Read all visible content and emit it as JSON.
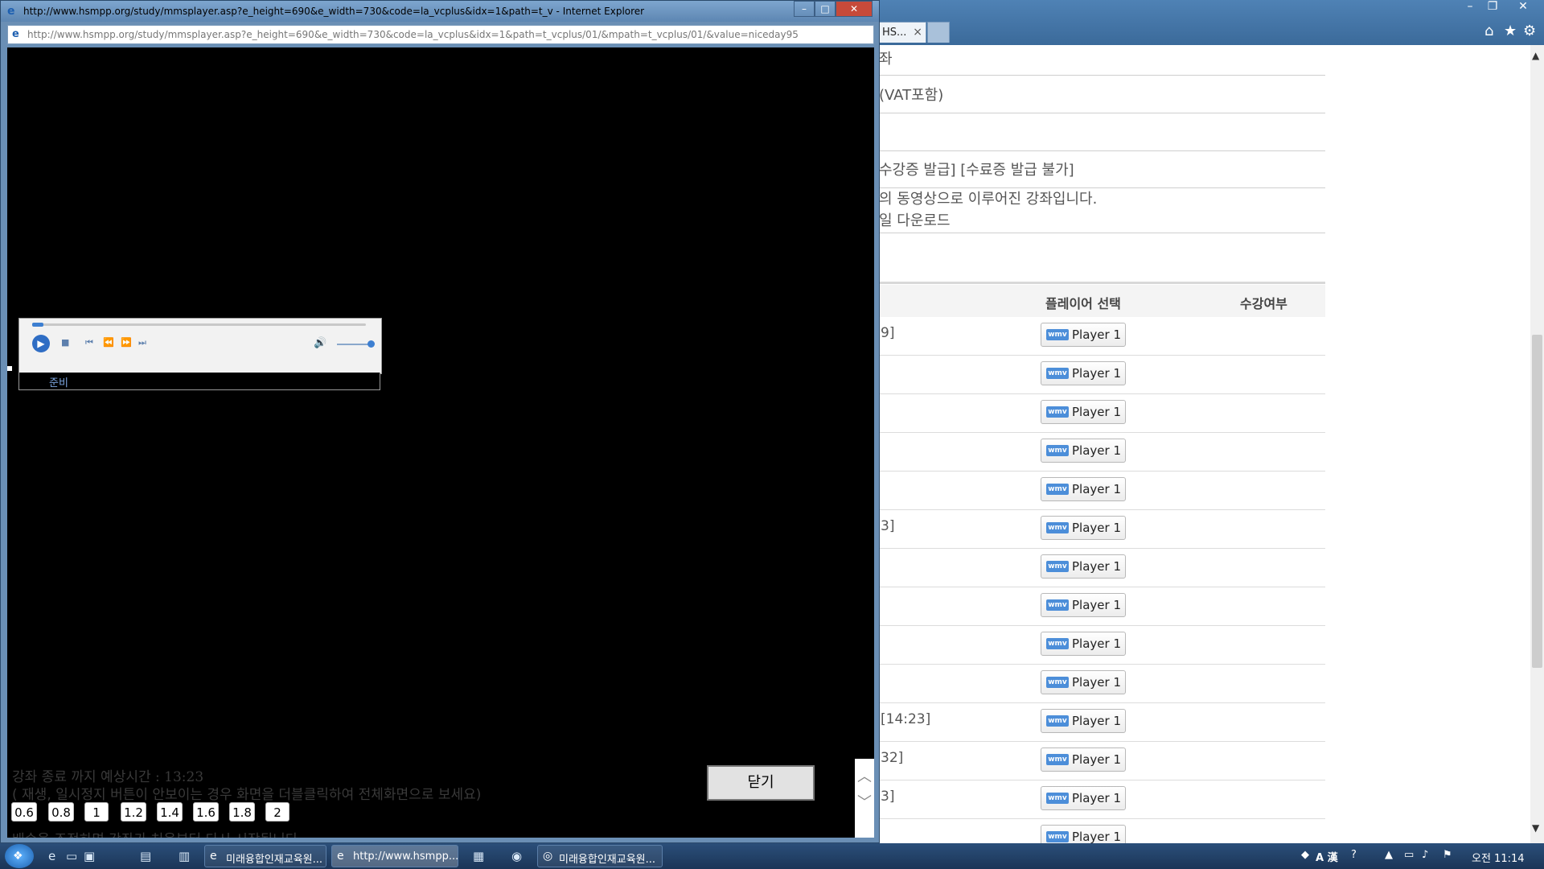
{
  "background_window": {
    "tab_label": "HS...",
    "info_lines": [
      "좌",
      "(VAT포함)",
      "수강증 발급] [수료증 발급 불가]",
      "의 동영상으로 이루어진 강좌입니다.",
      "일 다운로드"
    ],
    "table_headers": {
      "player": "플레이어 선택",
      "status": "수강여부"
    },
    "rows": [
      {
        "text": "9]",
        "button": "Player 1"
      },
      {
        "text": "",
        "button": "Player 1"
      },
      {
        "text": "",
        "button": "Player 1"
      },
      {
        "text": "",
        "button": "Player 1"
      },
      {
        "text": "",
        "button": "Player 1"
      },
      {
        "text": "3]",
        "button": "Player 1"
      },
      {
        "text": "",
        "button": "Player 1"
      },
      {
        "text": "",
        "button": "Player 1"
      },
      {
        "text": "",
        "button": "Player 1"
      },
      {
        "text": "",
        "button": "Player 1"
      },
      {
        "text": "[14:23]",
        "button": "Player 1"
      },
      {
        "text": "32]",
        "button": "Player 1"
      },
      {
        "text": "3]",
        "button": "Player 1"
      },
      {
        "text": "",
        "button": "Player 1"
      }
    ],
    "wmv_badge": "wmv"
  },
  "popup": {
    "title": "http://www.hsmpp.org/study/mmsplayer.asp?e_height=690&e_width=730&code=la_vcplus&idx=1&path=t_v - Internet Explorer",
    "address": "http://www.hsmpp.org/study/mmsplayer.asp?e_height=690&e_width=730&code=la_vcplus&idx=1&path=t_vcplus/01/&mpath=t_vcplus/01/&value=niceday95",
    "player_status": "준비",
    "eta": "강좌 종료 까지 예상시간 : 13:23",
    "hint": "( 재생, 일시정지 버튼이 안보이는 경우 화면을 더블클릭하여 전체화면으로 보세요)",
    "speeds": [
      "0.6",
      "0.8",
      "1",
      "1.2",
      "1.4",
      "1.6",
      "1.8",
      "2"
    ],
    "bottom_note": "배속을 조정하면 강좌가 처음부터 다시 시작됩니다.",
    "close_label": "닫기"
  },
  "taskbar": {
    "tasks": [
      {
        "label": "미래융합인재교육원..."
      },
      {
        "label": "http://www.hsmpp...."
      },
      {
        "label": "미래융합인재교육원..."
      }
    ],
    "ime": "A 漢",
    "clock": "오전 11:14"
  }
}
